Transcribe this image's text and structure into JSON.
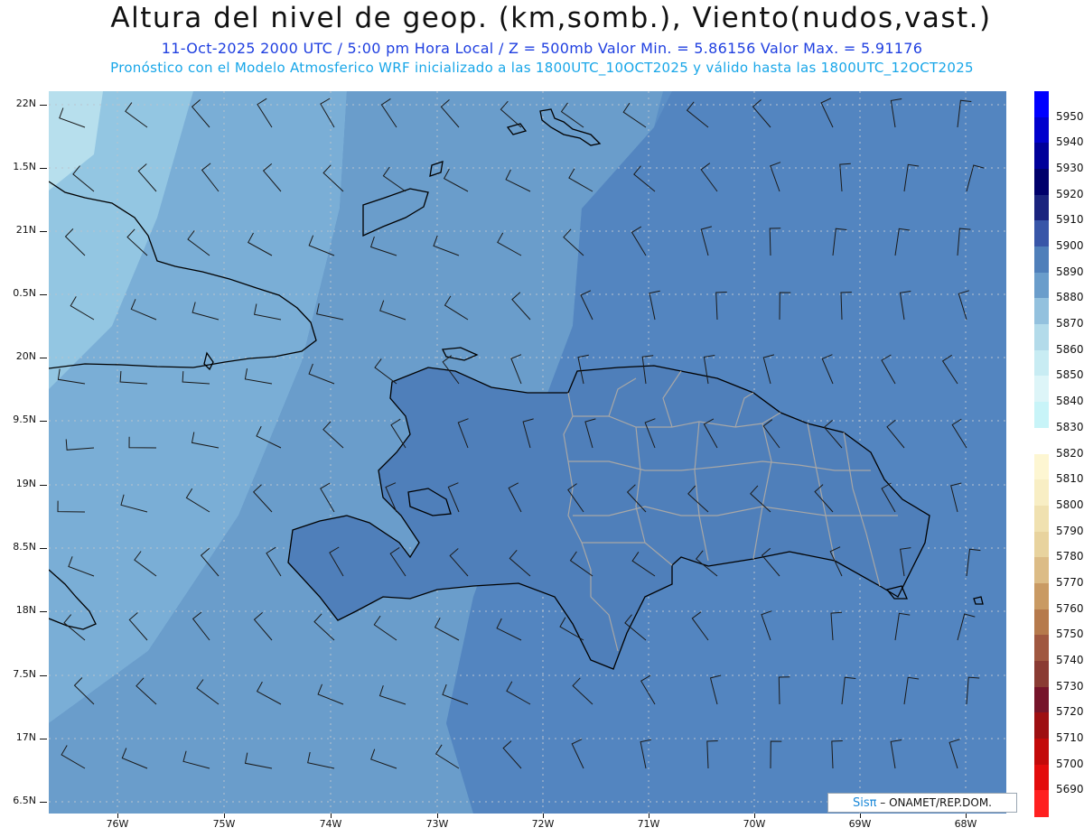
{
  "header": {
    "title": "Altura del nivel de geop. (km,somb.), Viento(nudos,vast.)",
    "subtitle": "11-Oct-2025  2000 UTC / 5:00 pm Hora Local / Z = 500mb     Valor Min. = 5.86156  Valor Max. = 5.91176",
    "model_line": "Pronóstico con el Modelo Atmosferico WRF inicializado a las 1800UTC_10OCT2025 y válido hasta las  1800UTC_12OCT2025"
  },
  "axes": {
    "lat_labels": [
      "22N",
      "1.5N",
      "21N",
      "0.5N",
      "20N",
      "9.5N",
      "19N",
      "8.5N",
      "18N",
      "7.5N",
      "17N",
      "6.5N"
    ],
    "lon_labels": [
      "76W",
      "75W",
      "74W",
      "73W",
      "72W",
      "71W",
      "70W",
      "69W",
      "68W"
    ]
  },
  "colorbar": {
    "levels": [
      "5950",
      "5940",
      "5930",
      "5920",
      "5910",
      "5900",
      "5890",
      "5880",
      "5870",
      "5860",
      "5850",
      "5840",
      "5830",
      "5820",
      "5810",
      "5800",
      "5790",
      "5780",
      "5770",
      "5760",
      "5750",
      "5740",
      "5730",
      "5720",
      "5710",
      "5700",
      "5690"
    ],
    "colors": [
      "#0000ff",
      "#0000cd",
      "#00009a",
      "#00006b",
      "#1a237e",
      "#3856a8",
      "#4f7fba",
      "#6a9dcb",
      "#93c1de",
      "#b3dbea",
      "#c8ecf3",
      "#ddf5f8",
      "#c8f4f8",
      "#ffffff",
      "#fdf6d2",
      "#f8eec4",
      "#f0e1b0",
      "#e8d39e",
      "#dcbc86",
      "#c99a63",
      "#b67a4c",
      "#a05840",
      "#8a3b33",
      "#76142a",
      "#9e0f12",
      "#c30a0a",
      "#e30c0c",
      "#ff2020"
    ]
  },
  "map_colors": {
    "sea_light": "#8fc1e0",
    "sea_mid": "#6a9dcb",
    "sea_dark": "#5b8fc6",
    "land_shade": "#4f7fba",
    "coast": "#000000",
    "province_borders": "#a7a7a7"
  },
  "credit": {
    "brand": "Sisπ",
    "text": "– ONAMET/REP.DOM."
  }
}
